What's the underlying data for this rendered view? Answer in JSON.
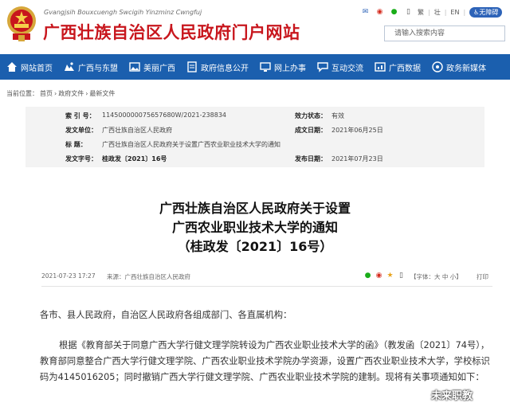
{
  "header": {
    "site_name_en": "Gvangjsih Bouxcuengh Swcigih Yinzminz Cwngfuj",
    "site_name_cn": "广西壮族自治区人民政府门户网站",
    "tools": {
      "lang_simplified": "繁",
      "lang_ethnic": "壮",
      "lang_en": "EN",
      "accessibility": "无障碍"
    },
    "search": {
      "placeholder": "请输入搜索内容"
    }
  },
  "nav": {
    "items": [
      {
        "label": "网站首页",
        "icon": "home-icon"
      },
      {
        "label": "广西与东盟",
        "icon": "asean-icon"
      },
      {
        "label": "美丽广西",
        "icon": "landscape-icon"
      },
      {
        "label": "政府信息公开",
        "icon": "document-icon"
      },
      {
        "label": "网上办事",
        "icon": "computer-icon"
      },
      {
        "label": "互动交流",
        "icon": "chat-icon"
      },
      {
        "label": "广西数据",
        "icon": "data-icon"
      },
      {
        "label": "政务新媒体",
        "icon": "new-media-icon"
      }
    ]
  },
  "breadcrumb": {
    "prefix": "当前位置：",
    "items": [
      "首页",
      "政府文件",
      "最新文件"
    ],
    "separator": "›"
  },
  "meta": {
    "index_label": "索  引  号：",
    "index_value": "114500000075657680W/2021-238834",
    "status_label": "效力状态：",
    "status_value": "有效",
    "issuer_label": "发文单位：",
    "issuer_value": "广西壮族自治区人民政府",
    "date_label": "成文日期：",
    "date_value": "2021年06月25日",
    "title_label": "标        题：",
    "title_value": "广西壮族自治区人民政府关于设置广西农业职业技术大学的通知",
    "docnum_label": "发文字号：",
    "docnum_value": "桂政发〔2021〕16号",
    "publish_label": "发布日期：",
    "publish_value": "2021年07月23日"
  },
  "article": {
    "title_line1": "广西壮族自治区人民政府关于设置",
    "title_line2": "广西农业职业技术大学的通知",
    "title_line3": "（桂政发〔2021〕16号）",
    "datetime": "2021-07-23 17:27",
    "source": "来源：广西壮族自治区人民政府",
    "font_size": "【字体：大 中 小】",
    "print": "打印",
    "para1": "各市、县人民政府，自治区人民政府各组成部门、各直属机构：",
    "para2": "根据《教育部关于同意广西大学行健文理学院转设为广西农业职业技术大学的函》（教发函〔2021〕74号），教育部同意整合广西大学行健文理学院、广西农业职业技术学院办学资源，设置广西农业职业技术大学，学校标识码为4145016205；同时撤销广西大学行健文理学院、广西农业职业技术学院的建制。现将有关事项通知如下："
  },
  "watermark": "未来职教",
  "colors": {
    "brand_red": "#c8161d",
    "nav_blue": "#1b5fae",
    "meta_bg": "#f3f3f3"
  }
}
